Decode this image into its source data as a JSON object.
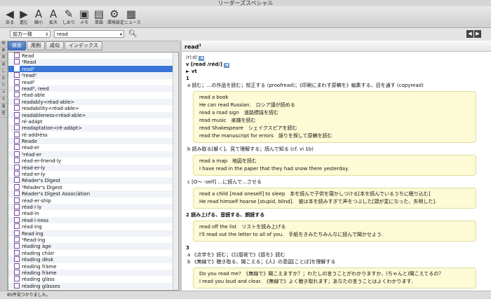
{
  "window": {
    "title": "リーダーズスペシャル"
  },
  "toolbar": [
    {
      "label": "戻る",
      "icon": "back-arrow-icon",
      "glyph": "◀"
    },
    {
      "label": "進む",
      "icon": "forward-arrow-icon",
      "glyph": "▶"
    },
    {
      "label": "縮小",
      "icon": "font-shrink-icon",
      "glyph": "A"
    },
    {
      "label": "拡大",
      "icon": "font-enlarge-icon",
      "glyph": "A"
    },
    {
      "label": "しおり",
      "icon": "bookmark-icon",
      "glyph": "✎"
    },
    {
      "label": "メモ",
      "icon": "memo-icon",
      "glyph": "▣"
    },
    {
      "label": "単語",
      "icon": "wordbook-icon",
      "glyph": "▤"
    },
    {
      "label": "環境設定",
      "icon": "gear-icon",
      "glyph": "⚙"
    },
    {
      "label": "ニュース",
      "icon": "news-icon",
      "glyph": "▦"
    }
  ],
  "search": {
    "mode": "前方一致",
    "query": "read"
  },
  "sidestrip": [
    "検",
    "索",
    "単",
    "語",
    "し",
    "お",
    "り",
    "メ",
    "モ",
    "履",
    "歴"
  ],
  "tabs": [
    "検索",
    "用例",
    "成句",
    "インデックス"
  ],
  "list": [
    "Read",
    "²Read",
    "read¹",
    "²read¹",
    "read²",
    "read³, reed",
    "réad·able",
    "readably<réad·able>",
    "readability<réad·able>",
    "readableness<réad·able>",
    "ré·adápt",
    "readaptation<ré·adápt>",
    "ré·addréss",
    "Reade",
    "réad·er",
    "²réad·er",
    "réad·er-friend·ly",
    "réad·er-ly",
    "réad·er-ly",
    "Réader's Dìgest",
    "²Réader's Dìgest",
    "Réader's Dìgest Associàtion",
    "réad·er·shìp",
    "réad·i·ly",
    "réad-ìn",
    "réad·i·ness",
    "réad·ing",
    "Read·ing",
    "²Read·ing",
    "réading àge",
    "réading chàir",
    "réading dèsk",
    "réading fràme",
    "réading fràme",
    "réading glàss",
    "réading glàsses"
  ],
  "selected_index": 2,
  "content": {
    "headword": "read",
    "headword_sup": "1",
    "pron": "/ríːd/",
    "pos_line": "v [read /réd/]",
    "vt": "vt",
    "sense1": "1",
    "a_def": "a 読む；…の作品を読む；校正する (proofread)；《印刷にまわす原稿を》編集する、目を通す (copyread)",
    "a_examples": [
      "read a book",
      "He can read Russian.　ロシア語が読める",
      "read a road sign　道路標識を読む",
      "read music　楽譜を読む",
      "read Shakespeare　シェイクスピアを読む",
      "read the manuscript for errors　誤りを探して原稿を読む"
    ],
    "b_def": "b 読み取る[解く]、見て理解する；読んで知る (cf. vi 1b)",
    "b_examples": [
      "read a map　地図を読む",
      "I have read in the paper that they had snow there yesterday."
    ],
    "c_def": "c [O〜 -self] …に読んで…させる",
    "c_examples": [
      "read a child [read oneself] to sleep　本を読んで子供を寝かしつける[本を読んでいるうちに眠り込む]",
      "He read himself hoarse [stupid, blind].　彼は本を読みすぎて声をつぶした[頭が変になった、失明した]."
    ],
    "sense2": "2 読み上げる、音読する、朗読する",
    "s2_examples": [
      "read off the list　リストを読み上げる",
      "I'll read out the letter to all of you.　手紙をきみたちみんなに読んで聞かせよう."
    ],
    "sense3": "3",
    "s3a": "a 《点字を》読む；《口唇術で》《唇を》読む",
    "s3b": "b 《無線で》聴き取る、聞こえる；《人》の意図[ことば]を理解する",
    "s3_examples": [
      "Do you read me?　《無線で》聞こえますか？；わたしの言うことがわかりますか、(ちゃんと)聞こえてるの？",
      "I read you loud and clear.　《無線で》よく聴き取れます；あなたの言うことはよくわかります."
    ]
  },
  "status": "85件見つかりました。"
}
